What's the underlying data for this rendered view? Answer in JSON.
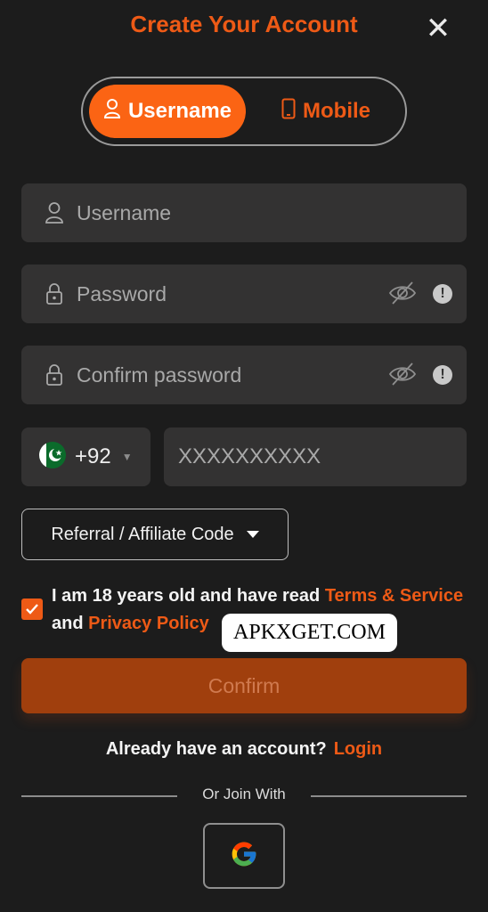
{
  "header": {
    "title": "Create Your Account",
    "close_glyph": "✕"
  },
  "tabs": [
    {
      "label": "Username",
      "icon": "user-icon",
      "active": true
    },
    {
      "label": "Mobile",
      "icon": "phone-icon",
      "active": false
    }
  ],
  "form": {
    "username": {
      "placeholder": "Username",
      "value": ""
    },
    "password": {
      "placeholder": "Password",
      "value": ""
    },
    "confirm_password": {
      "placeholder": "Confirm password",
      "value": ""
    },
    "country_code": "+92",
    "phone": {
      "placeholder": "XXXXXXXXXX",
      "value": ""
    },
    "referral_label": "Referral / Affiliate Code",
    "info_glyph": "!"
  },
  "agreement": {
    "checked": true,
    "text_before": "I am 18 years old and have read ",
    "terms_link": "Terms & Service",
    "text_and": "and ",
    "privacy_link": "Privacy Policy"
  },
  "watermark": "APKXGET.COM",
  "confirm_label": "Confirm",
  "login": {
    "prompt": "Already have an account?",
    "link": "Login"
  },
  "social": {
    "divider_text": "Or Join With",
    "providers": [
      "google-icon"
    ]
  },
  "colors": {
    "accent": "#ee5a16",
    "background": "#1c1c1c",
    "field": "#333232",
    "confirm_disabled": "#a03f0d"
  }
}
